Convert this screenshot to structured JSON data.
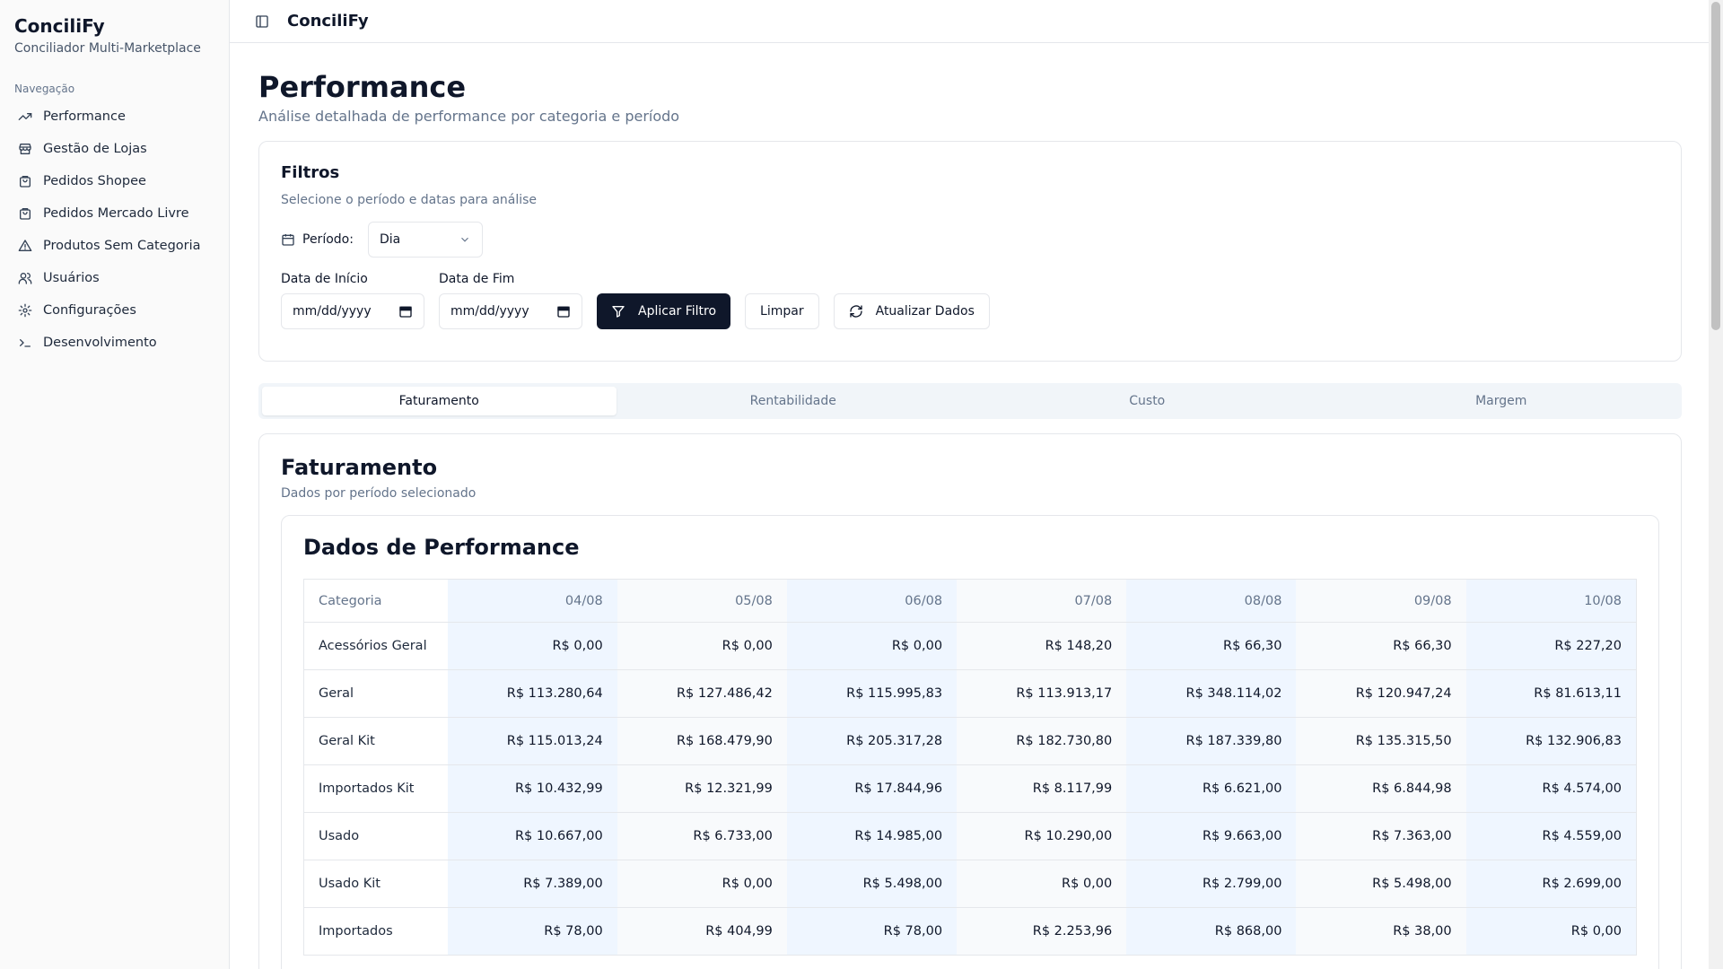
{
  "app": {
    "name": "ConciliFy",
    "subtitle": "Conciliador Multi-Marketplace"
  },
  "sidebar": {
    "section_label": "Navegação",
    "items": [
      {
        "label": "Performance",
        "icon": "trending-up-icon"
      },
      {
        "label": "Gestão de Lojas",
        "icon": "store-icon"
      },
      {
        "label": "Pedidos Shopee",
        "icon": "shopping-bag-icon"
      },
      {
        "label": "Pedidos Mercado Livre",
        "icon": "shopping-bag-icon"
      },
      {
        "label": "Produtos Sem Categoria",
        "icon": "alert-triangle-icon"
      },
      {
        "label": "Usuários",
        "icon": "users-icon"
      },
      {
        "label": "Configurações",
        "icon": "gear-icon"
      },
      {
        "label": "Desenvolvimento",
        "icon": "terminal-icon"
      }
    ]
  },
  "header": {
    "title": "ConciliFy"
  },
  "page": {
    "title": "Performance",
    "subtitle": "Análise detalhada de performance por categoria e período"
  },
  "filters": {
    "title": "Filtros",
    "subtitle": "Selecione o período e datas para análise",
    "periodo_label": "Período:",
    "periodo_value": "Dia",
    "start_label": "Data de Início",
    "start_value": "mm/dd/yyyy",
    "end_label": "Data de Fim",
    "end_value": "mm/dd/yyyy",
    "apply_label": "Aplicar Filtro",
    "clear_label": "Limpar",
    "refresh_label": "Atualizar Dados"
  },
  "tabs": [
    "Faturamento",
    "Rentabilidade",
    "Custo",
    "Margem"
  ],
  "active_tab": "Faturamento",
  "content": {
    "title": "Faturamento",
    "subtitle": "Dados por período selecionado",
    "table_title": "Dados de Performance"
  },
  "table": {
    "columns": [
      "Categoria",
      "04/08",
      "05/08",
      "06/08",
      "07/08",
      "08/08",
      "09/08",
      "10/08"
    ],
    "rows": [
      [
        "Acessórios Geral",
        "R$ 0,00",
        "R$ 0,00",
        "R$ 0,00",
        "R$ 148,20",
        "R$ 66,30",
        "R$ 66,30",
        "R$ 227,20"
      ],
      [
        "Geral",
        "R$ 113.280,64",
        "R$ 127.486,42",
        "R$ 115.995,83",
        "R$ 113.913,17",
        "R$ 348.114,02",
        "R$ 120.947,24",
        "R$ 81.613,11"
      ],
      [
        "Geral Kit",
        "R$ 115.013,24",
        "R$ 168.479,90",
        "R$ 205.317,28",
        "R$ 182.730,80",
        "R$ 187.339,80",
        "R$ 135.315,50",
        "R$ 132.906,83"
      ],
      [
        "Importados Kit",
        "R$ 10.432,99",
        "R$ 12.321,99",
        "R$ 17.844,96",
        "R$ 8.117,99",
        "R$ 6.621,00",
        "R$ 6.844,98",
        "R$ 4.574,00"
      ],
      [
        "Usado",
        "R$ 10.667,00",
        "R$ 6.733,00",
        "R$ 14.985,00",
        "R$ 10.290,00",
        "R$ 9.663,00",
        "R$ 7.363,00",
        "R$ 4.559,00"
      ],
      [
        "Usado Kit",
        "R$ 7.389,00",
        "R$ 0,00",
        "R$ 5.498,00",
        "R$ 0,00",
        "R$ 2.799,00",
        "R$ 5.498,00",
        "R$ 2.699,00"
      ],
      [
        "Importados",
        "R$ 78,00",
        "R$ 404,99",
        "R$ 78,00",
        "R$ 2.253,96",
        "R$ 868,00",
        "R$ 38,00",
        "R$ 0,00"
      ]
    ]
  }
}
